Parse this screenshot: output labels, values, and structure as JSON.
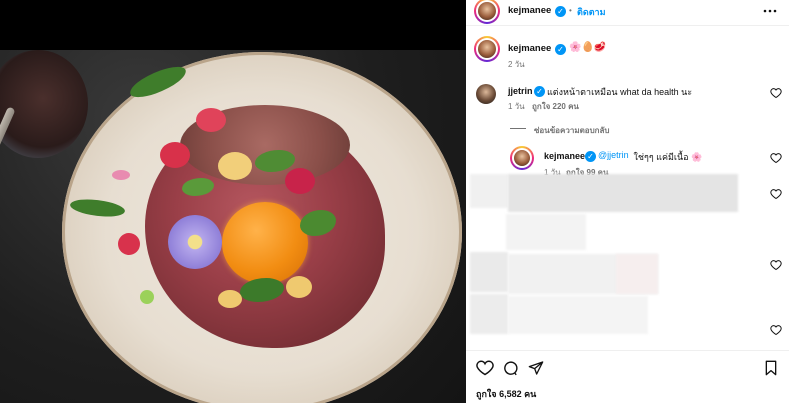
{
  "post": {
    "author": "kejmanee",
    "follow_label": "ติดตาม",
    "separator": "•",
    "more_icon": "more-horizontal-icon",
    "caption_emojis": "🌸🥚🥩",
    "caption_time": "2 วัน"
  },
  "comments": [
    {
      "username": "jjetrin",
      "text": "แต่งหน้าตาเหมือน what da health นะ",
      "time": "1 วัน",
      "likes": "ถูกใจ 220 คน"
    }
  ],
  "replies": {
    "toggle_label": "ซ่อนข้อความตอบกลับ",
    "items": [
      {
        "username": "kejmanee",
        "mention": "@jjetrin",
        "text": " ใช่ๆๆ แค่มีเนื้อ 🌸",
        "time": "1 วัน",
        "likes": "ถูกใจ 99 คน"
      }
    ]
  },
  "footer": {
    "likes_count": "ถูกใจ 6,582 คน"
  },
  "colors": {
    "accent": "#0095f6",
    "muted": "#737373"
  }
}
